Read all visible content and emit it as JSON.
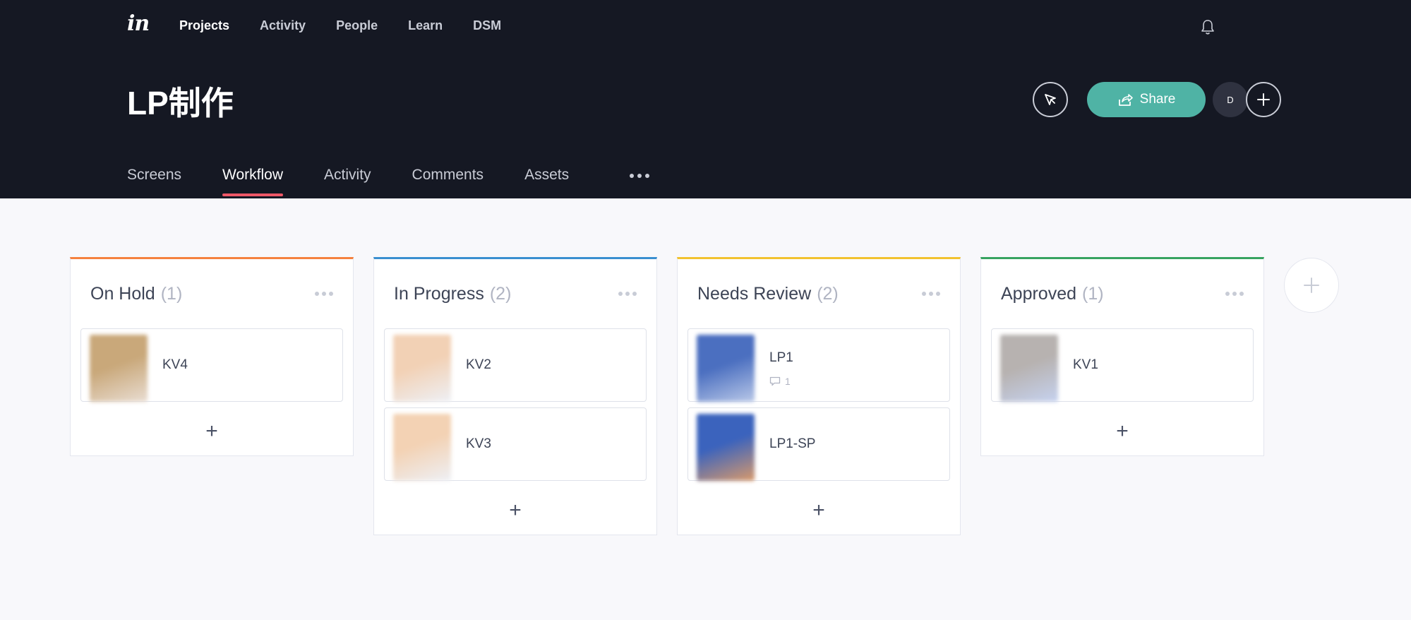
{
  "topnav": {
    "logo": "in",
    "items": [
      "Projects",
      "Activity",
      "People",
      "Learn",
      "DSM"
    ],
    "active_index": 0
  },
  "project": {
    "title": "LP制作",
    "share_label": "Share",
    "avatar_initial": "D"
  },
  "tabs": {
    "items": [
      "Screens",
      "Workflow",
      "Activity",
      "Comments",
      "Assets"
    ],
    "active_index": 1
  },
  "columns": [
    {
      "title": "On Hold",
      "count": "(1)",
      "accent": "#f5813e",
      "cards": [
        {
          "name": "KV4",
          "thumb_colors": [
            "#c9a87a",
            "#e9ddd2"
          ]
        }
      ]
    },
    {
      "title": "In Progress",
      "count": "(2)",
      "accent": "#3a8fd0",
      "cards": [
        {
          "name": "KV2",
          "thumb_colors": [
            "#f2d1b5",
            "#eef0f5"
          ]
        },
        {
          "name": "KV3",
          "thumb_colors": [
            "#f3d2b4",
            "#eef0f5"
          ]
        }
      ]
    },
    {
      "title": "Needs Review",
      "count": "(2)",
      "accent": "#f2c22f",
      "cards": [
        {
          "name": "LP1",
          "comments": "1",
          "thumb_colors": [
            "#4b6fc0",
            "#b9c8e8"
          ]
        },
        {
          "name": "LP1-SP",
          "thumb_colors": [
            "#3b63bd",
            "#d99a6b"
          ]
        }
      ]
    },
    {
      "title": "Approved",
      "count": "(1)",
      "accent": "#37a360",
      "cards": [
        {
          "name": "KV1",
          "thumb_colors": [
            "#b7b2b0",
            "#c6d2ef"
          ]
        }
      ]
    }
  ],
  "colors": {
    "header_bg": "#151823",
    "share_button": "#4fb3a5",
    "active_tab_underline": "#ef5867",
    "page_bg": "#f8f8fb"
  }
}
